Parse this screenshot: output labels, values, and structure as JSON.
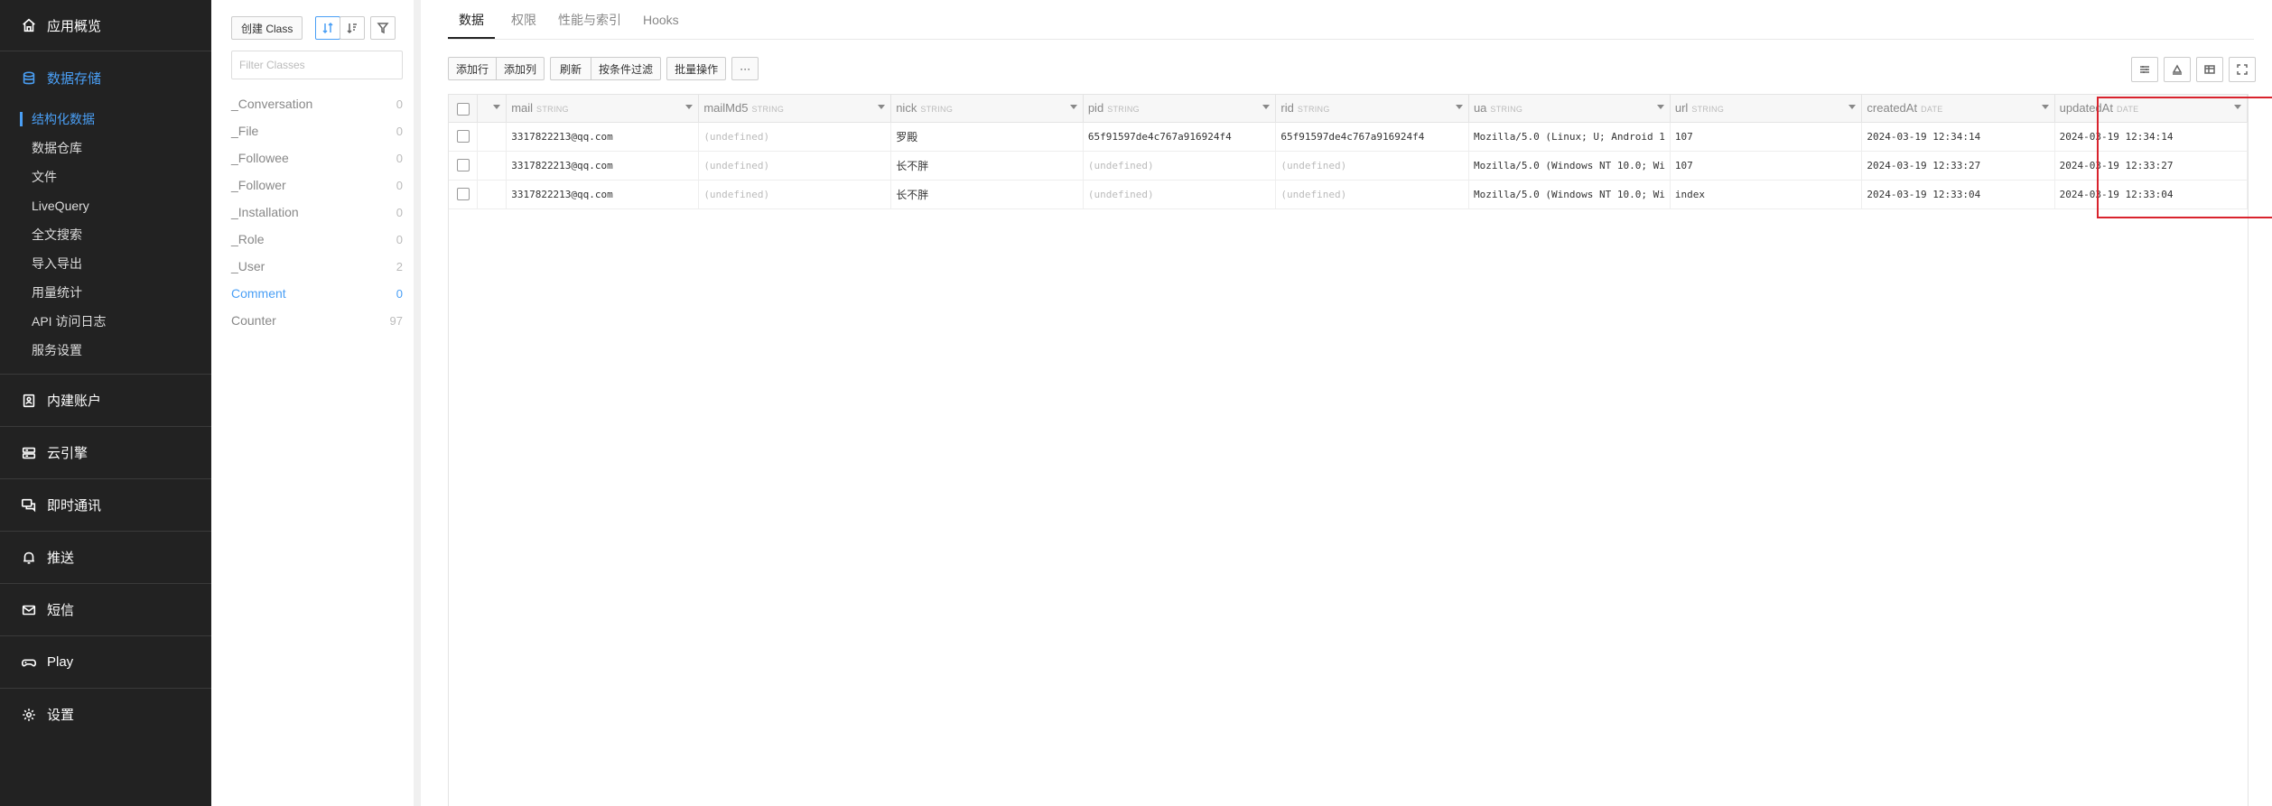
{
  "nav": {
    "overview": "应用概览",
    "storage": "数据存储",
    "storage_items": [
      "结构化数据",
      "数据仓库",
      "文件",
      "LiveQuery",
      "全文搜索",
      "导入导出",
      "用量统计",
      "API 访问日志",
      "服务设置"
    ],
    "sections": [
      {
        "label": "内建账户",
        "icon": "user-card-icon"
      },
      {
        "label": "云引擎",
        "icon": "server-icon"
      },
      {
        "label": "即时通讯",
        "icon": "chat-icon"
      },
      {
        "label": "推送",
        "icon": "bell-icon"
      },
      {
        "label": "短信",
        "icon": "mail-icon"
      },
      {
        "label": "Play",
        "icon": "gamepad-icon"
      },
      {
        "label": "设置",
        "icon": "gear-icon"
      }
    ],
    "accent": "#4a9ff5"
  },
  "classes": {
    "create_label": "创建 Class",
    "filter_placeholder": "Filter Classes",
    "items": [
      {
        "name": "_Conversation",
        "count": "0"
      },
      {
        "name": "_File",
        "count": "0"
      },
      {
        "name": "_Followee",
        "count": "0"
      },
      {
        "name": "_Follower",
        "count": "0"
      },
      {
        "name": "_Installation",
        "count": "0"
      },
      {
        "name": "_Role",
        "count": "0"
      },
      {
        "name": "_User",
        "count": "2"
      },
      {
        "name": "Comment",
        "count": "0"
      },
      {
        "name": "Counter",
        "count": "97"
      }
    ],
    "selected": "Comment"
  },
  "tabs": [
    "数据",
    "权限",
    "性能与索引",
    "Hooks"
  ],
  "toolbar": {
    "group1": [
      "添加行",
      "添加列"
    ],
    "group2": [
      "刷新",
      "按条件过滤"
    ],
    "batch": "批量操作",
    "more": "···"
  },
  "table": {
    "columns": [
      {
        "name": "mail",
        "type": "STRING"
      },
      {
        "name": "mailMd5",
        "type": "STRING"
      },
      {
        "name": "nick",
        "type": "STRING"
      },
      {
        "name": "pid",
        "type": "STRING"
      },
      {
        "name": "rid",
        "type": "STRING"
      },
      {
        "name": "ua",
        "type": "STRING"
      },
      {
        "name": "url",
        "type": "STRING"
      },
      {
        "name": "createdAt",
        "type": "DATE"
      },
      {
        "name": "updatedAt",
        "type": "DATE"
      }
    ],
    "rows": [
      [
        "3317822213@qq.com",
        "(undefined)",
        "罗殿",
        "65f91597de4c767a916924f4",
        "65f91597de4c767a916924f4",
        "Mozilla/5.0 (Linux; U; Android 1",
        "107",
        "2024-03-19 12:34:14",
        "2024-03-19 12:34:14"
      ],
      [
        "3317822213@qq.com",
        "(undefined)",
        "长不胖",
        "(undefined)",
        "(undefined)",
        "Mozilla/5.0 (Windows NT 10.0; Wi",
        "107",
        "2024-03-19 12:33:27",
        "2024-03-19 12:33:27"
      ],
      [
        "3317822213@qq.com",
        "(undefined)",
        "长不胖",
        "(undefined)",
        "(undefined)",
        "Mozilla/5.0 (Windows NT 10.0; Wi",
        "index",
        "2024-03-19 12:33:04",
        "2024-03-19 12:33:04"
      ]
    ],
    "highlight_color": "#d9232d"
  }
}
